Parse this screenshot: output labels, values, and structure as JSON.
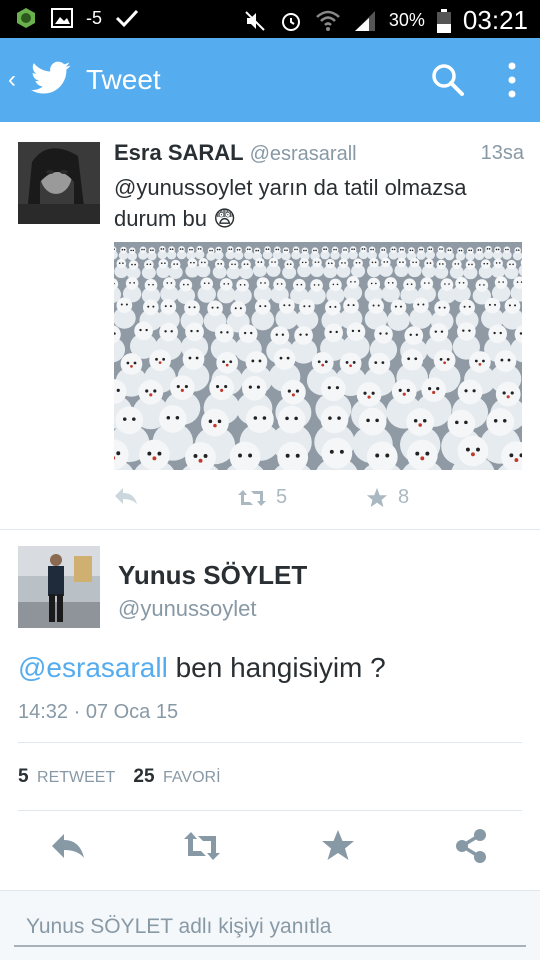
{
  "status_bar": {
    "notification_count": "-5",
    "battery": "30%",
    "time": "03:21"
  },
  "app_bar": {
    "title": "Tweet",
    "color": "#55acee",
    "icons": [
      "back-chevron-icon",
      "twitter-bird-icon",
      "search-icon",
      "more-vert-icon"
    ]
  },
  "tweet": {
    "author_name": "Esra SARAL",
    "handle": "@esrasarall",
    "time": "13sa",
    "text": "@yunussoylet yarın da tatil olmazsa durum bu",
    "emoji": "😨",
    "retweets": "5",
    "favorites": "8"
  },
  "reply_tweet": {
    "author_name": "Yunus SÖYLET",
    "handle": "@yunussoylet",
    "mention": "@esrasarall",
    "text": " ben hangisiyim ?",
    "timestamp": "14:32 · 07 Oca 15",
    "retweet_count": "5",
    "retweet_label": "RETWEET",
    "favorite_count": "25",
    "favorite_label": "FAVORİ"
  },
  "reply_box": {
    "placeholder": "Yunus SÖYLET adlı kişiyi yanıtla"
  }
}
